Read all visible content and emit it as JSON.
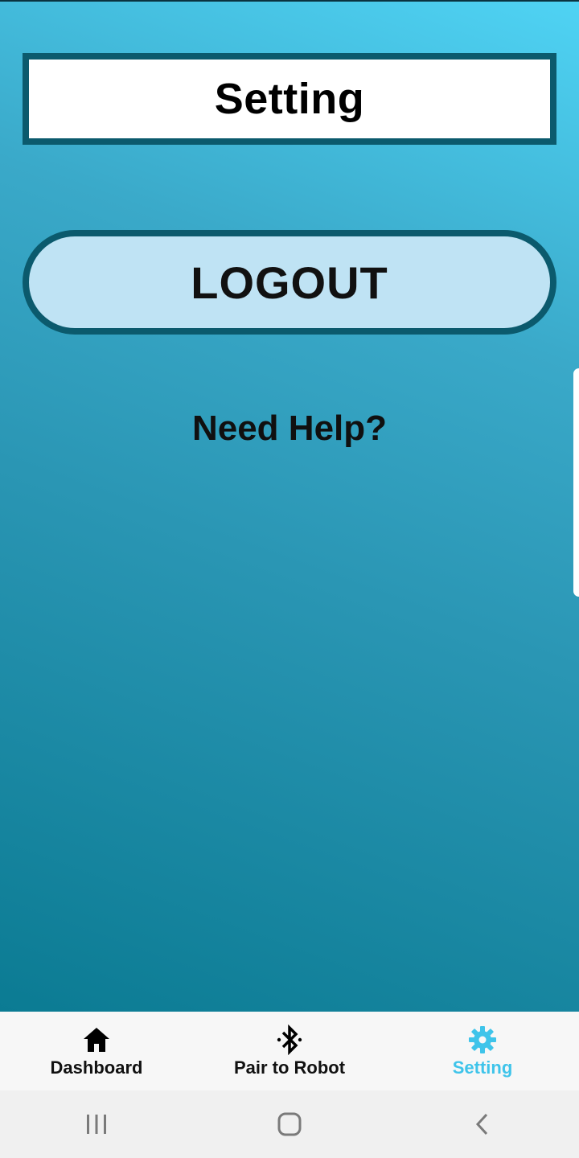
{
  "header": {
    "title": "Setting"
  },
  "main": {
    "logout_label": "LOGOUT",
    "help_label": "Need Help?"
  },
  "tabbar": {
    "items": [
      {
        "label": "Dashboard",
        "icon": "home-icon",
        "active": false
      },
      {
        "label": "Pair to Robot",
        "icon": "bluetooth-icon",
        "active": false
      },
      {
        "label": "Setting",
        "icon": "gear-icon",
        "active": true
      }
    ]
  },
  "system_nav": {
    "buttons": [
      "recent-apps-icon",
      "home-circle-icon",
      "back-icon"
    ]
  },
  "colors": {
    "gradient_top": "#4fd3f4",
    "gradient_bottom": "#0b7b93",
    "border": "#0b5a6d",
    "logout_bg": "#bfe3f4",
    "active_tab": "#3fc4ea"
  }
}
